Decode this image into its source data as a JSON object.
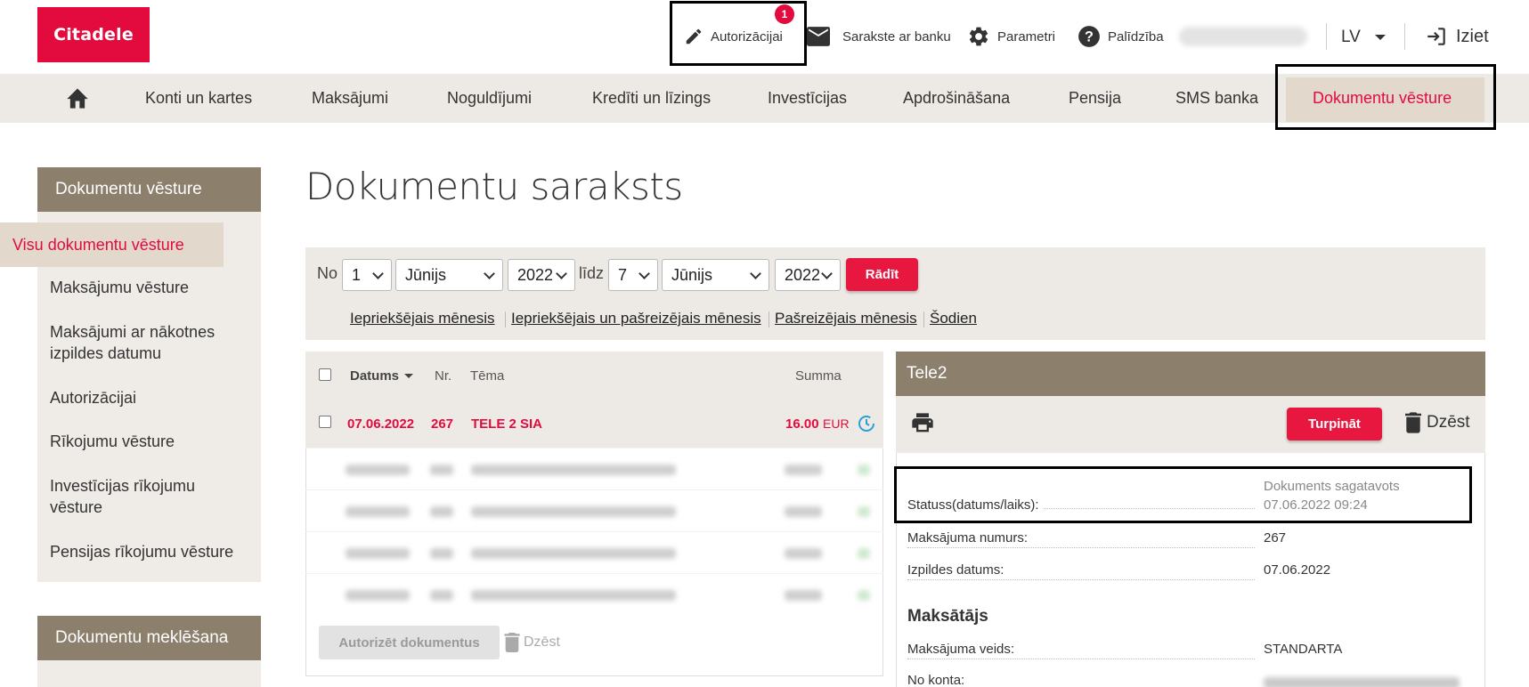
{
  "header": {
    "logo": "Citadele",
    "authorize": {
      "label": "Autorizācijai",
      "badge": "1"
    },
    "messages_label": "Sarakste ar banku",
    "settings_label": "Parametri",
    "help_label": "Palīdzība",
    "language": "LV",
    "logout_label": "Iziet"
  },
  "nav": {
    "items": [
      "Konti un kartes",
      "Maksājumi",
      "Noguldījumi",
      "Kredīti un līzings",
      "Investīcijas",
      "Apdrošināšana",
      "Pensija",
      "SMS banka",
      "Dokumentu vēsture"
    ],
    "active": "Dokumentu vēsture"
  },
  "sidebar": {
    "section1_title": "Dokumentu vēsture",
    "items": [
      "Visu dokumentu vēsture",
      "Maksājumu vēsture",
      "Maksājumi ar nākotnes izpildes datumu",
      "Autorizācijai",
      "Rīkojumu vēsture",
      "Investīcijas rīkojumu vēsture",
      "Pensijas rīkojumu vēsture"
    ],
    "section2_title": "Dokumentu meklēšana"
  },
  "page_title": "Dokumentu saraksts",
  "filter": {
    "from_label": "No",
    "from_day": "1",
    "from_month": "Jūnijs",
    "from_year": "2022",
    "to_label": "līdz",
    "to_day": "7",
    "to_month": "Jūnijs",
    "to_year": "2022",
    "show_button": "Rādīt",
    "quick_links": [
      "Iepriekšējais mēnesis",
      "Iepriekšējais un pašreizējais mēnesis",
      "Pašreizējais mēnesis",
      "Šodien"
    ]
  },
  "table": {
    "headers": {
      "date": "Datums",
      "nr": "Nr.",
      "subject": "Tēma",
      "amount": "Summa"
    },
    "rows": [
      {
        "date": "07.06.2022",
        "nr": "267",
        "subject": "TELE 2 SIA",
        "amount": "16.00",
        "currency": "EUR",
        "status_icon": "clock-icon"
      }
    ],
    "authorize_button": "Autorizēt dokumentus",
    "delete_label": "Dzēst"
  },
  "detail": {
    "title": "Tele2",
    "continue_button": "Turpināt",
    "delete_label": "Dzēst",
    "status_label": "Statuss(datums/laiks):",
    "status_value": "Dokuments sagatavots",
    "status_time": "07.06.2022 09:24",
    "payment_number_label": "Maksājuma numurs:",
    "payment_number": "267",
    "execution_date_label": "Izpildes datums:",
    "execution_date": "07.06.2022",
    "payer_section": "Maksātājs",
    "payment_type_label": "Maksājuma veids:",
    "payment_type": "STANDARTA",
    "from_account_label": "No konta:"
  },
  "colors": {
    "brand_red": "#e30b3e",
    "nav_bg": "#edeae5",
    "header_brown": "#8c7f6c",
    "active_bg": "#e2d8cc"
  }
}
